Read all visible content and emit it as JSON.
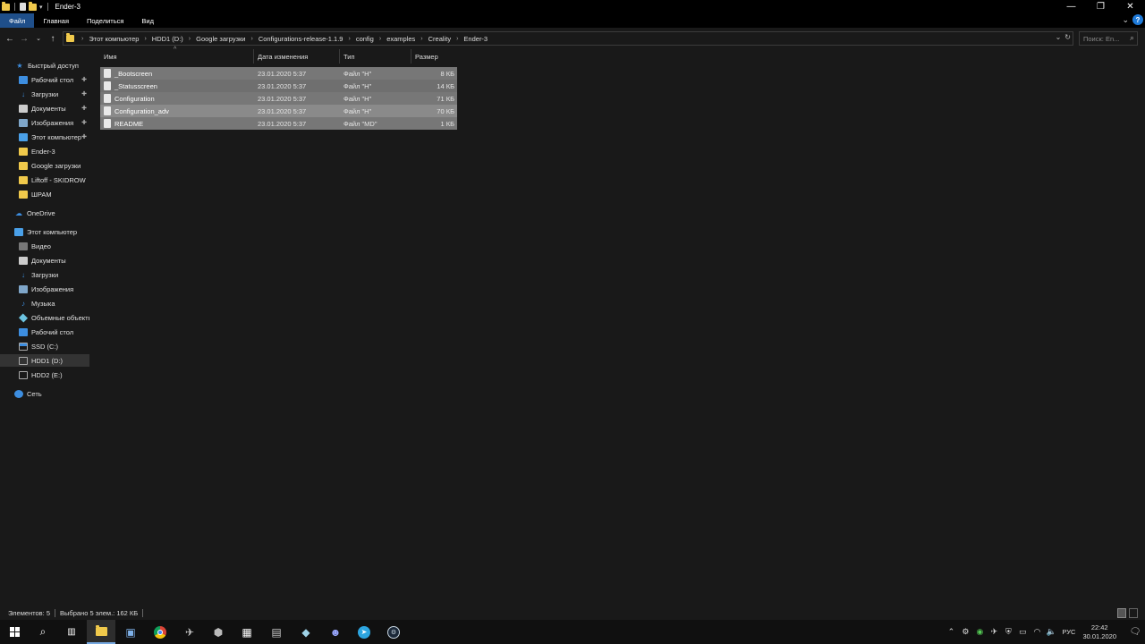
{
  "window": {
    "title": "Ender-3",
    "controls": {
      "minimize": "—",
      "maximize": "❐",
      "close": "✕"
    }
  },
  "ribbon": {
    "tabs": [
      "Файл",
      "Главная",
      "Поделиться",
      "Вид"
    ],
    "help": "?"
  },
  "address": {
    "crumbs": [
      "Этот компьютер",
      "HDD1 (D:)",
      "Google загрузки",
      "Configurations-release-1.1.9",
      "config",
      "examples",
      "Creality",
      "Ender-3"
    ],
    "search_placeholder": "Поиск: En..."
  },
  "sidebar": {
    "items": [
      {
        "label": "Быстрый доступ",
        "icon": "star-icon"
      },
      {
        "label": "Рабочий стол",
        "icon": "desktop-icon",
        "pinned": true
      },
      {
        "label": "Загрузки",
        "icon": "download-icon",
        "pinned": true
      },
      {
        "label": "Документы",
        "icon": "documents-icon",
        "pinned": true
      },
      {
        "label": "Изображения",
        "icon": "pictures-icon",
        "pinned": true
      },
      {
        "label": "Этот компьютер",
        "icon": "computer-icon",
        "pinned": true
      },
      {
        "label": "Ender-3",
        "icon": "folder-icon"
      },
      {
        "label": "Google загрузки",
        "icon": "folder-icon"
      },
      {
        "label": "Liftoff - SKIDROW",
        "icon": "folder-icon"
      },
      {
        "label": "ШРАМ",
        "icon": "folder-icon"
      },
      {
        "label": "OneDrive",
        "icon": "cloud-icon"
      },
      {
        "label": "Этот компьютер",
        "icon": "computer-icon"
      },
      {
        "label": "Видео",
        "icon": "video-icon"
      },
      {
        "label": "Документы",
        "icon": "documents-icon"
      },
      {
        "label": "Загрузки",
        "icon": "download-icon"
      },
      {
        "label": "Изображения",
        "icon": "pictures-icon"
      },
      {
        "label": "Музыка",
        "icon": "music-icon"
      },
      {
        "label": "Объемные объекты",
        "icon": "3d-objects-icon"
      },
      {
        "label": "Рабочий стол",
        "icon": "desktop-icon"
      },
      {
        "label": "SSD (C:)",
        "icon": "system-drive-icon"
      },
      {
        "label": "HDD1 (D:)",
        "icon": "drive-icon",
        "selected": true
      },
      {
        "label": "HDD2 (E:)",
        "icon": "drive-icon"
      },
      {
        "label": "Сеть",
        "icon": "network-icon"
      }
    ]
  },
  "list": {
    "columns": {
      "name": "Имя",
      "date": "Дата изменения",
      "type": "Тип",
      "size": "Размер"
    },
    "rows": [
      {
        "name": "_Bootscreen",
        "date": "23.01.2020 5:37",
        "type": "Файл \"H\"",
        "size": "8 КБ"
      },
      {
        "name": "_Statusscreen",
        "date": "23.01.2020 5:37",
        "type": "Файл \"H\"",
        "size": "14 КБ"
      },
      {
        "name": "Configuration",
        "date": "23.01.2020 5:37",
        "type": "Файл \"H\"",
        "size": "71 КБ"
      },
      {
        "name": "Configuration_adv",
        "date": "23.01.2020 5:37",
        "type": "Файл \"H\"",
        "size": "70 КБ"
      },
      {
        "name": "README",
        "date": "23.01.2020 5:37",
        "type": "Файл \"MD\"",
        "size": "1 КБ"
      }
    ]
  },
  "status": {
    "count": "Элементов: 5",
    "selected": "Выбрано 5 элем.: 162 КБ"
  },
  "taskbar": {
    "lang": "РУС",
    "time": "22:42",
    "date": "30.01.2020"
  }
}
